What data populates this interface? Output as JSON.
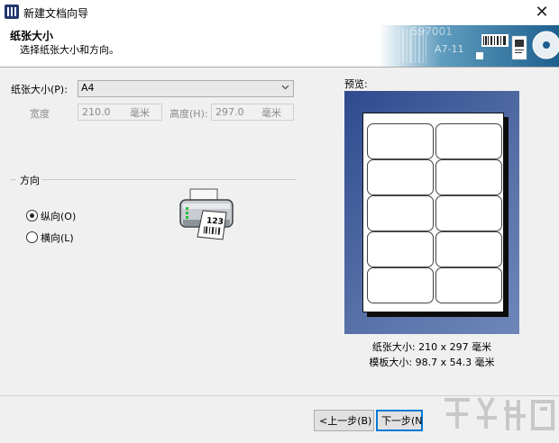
{
  "window": {
    "title": "新建文档向导",
    "close_glyph": "✕",
    "icon": "app-icon"
  },
  "header": {
    "title": "纸张大小",
    "subtitle": "选择纸张大小和方向。",
    "banner_text_1": "597001",
    "banner_text_2": "A7-11"
  },
  "form": {
    "paper_size_label": "纸张大小(P):",
    "paper_size_value": "A4",
    "width_label": "宽度",
    "width_value": "210.0",
    "width_unit": "毫米",
    "height_label": "高度(H):",
    "height_value": "297.0",
    "height_unit": "毫米"
  },
  "orientation": {
    "group_label": "方向",
    "portrait_label": "纵向(O)",
    "landscape_label": "横向(L)",
    "selected": "portrait"
  },
  "preview": {
    "label": "预览:",
    "paper_size_info": "纸张大小: 210 x 297 毫米",
    "template_size_info": "模板大小: 98.7 x 54.3 毫米",
    "rows": 5,
    "columns": 2
  },
  "buttons": {
    "prev_label": "<上一步(B)",
    "next_label": "下一步(N"
  },
  "colors": {
    "preview_bg": "#3a5596",
    "default_button_border": "#0078d7"
  }
}
